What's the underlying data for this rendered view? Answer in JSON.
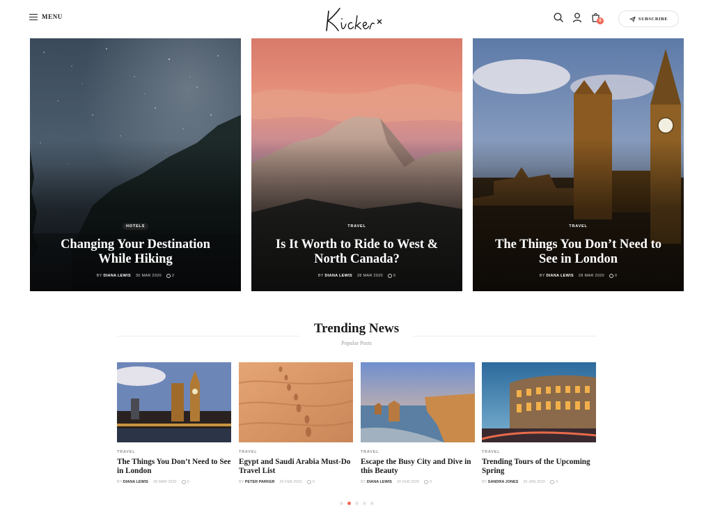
{
  "header": {
    "menu_label": "MENU",
    "logo_text": "Kicker",
    "cart_count": "0",
    "subscribe_label": "SUBSCRIBE",
    "accent_color": "#f06a57"
  },
  "hero": [
    {
      "category": "HOTELS",
      "title": "Changing Your Destination While Hiking",
      "by": "BY",
      "author": "DIANA LEWIS",
      "date": "30 MAR 2020",
      "comments": "2",
      "image": "starry-night-forest"
    },
    {
      "category": "TRAVEL",
      "title": "Is It Worth to Ride to West & North Canada?",
      "by": "BY",
      "author": "DIANA LEWIS",
      "date": "28 MAR 2020",
      "comments": "0",
      "image": "half-dome-sunset"
    },
    {
      "category": "TRAVEL",
      "title": "The Things You Don’t Need to See in London",
      "by": "BY",
      "author": "DIANA LEWIS",
      "date": "28 MAR 2020",
      "comments": "0",
      "image": "big-ben-westminster"
    }
  ],
  "trending": {
    "title": "Trending News",
    "subtitle": "Popular Posts",
    "posts": [
      {
        "category": "TRAVEL",
        "title": "The Things You Don’t Need to See in London",
        "by": "BY",
        "author": "DIANA LEWIS",
        "date": "28 MAR 2020",
        "comments": "0",
        "image": "london-night"
      },
      {
        "category": "TRAVEL",
        "title": "Egypt and Saudi Arabia Must-Do Travel List",
        "by": "BY",
        "author": "PETER PARKER",
        "date": "25 FEB 2020",
        "comments": "0",
        "image": "desert-footprints"
      },
      {
        "category": "TRAVEL",
        "title": "Escape the Busy City and Dive in this Beauty",
        "by": "BY",
        "author": "DIANA LEWIS",
        "date": "20 FEB 2020",
        "comments": "0",
        "image": "coastal-cliffs"
      },
      {
        "category": "TRAVEL",
        "title": "Trending Tours of the Upcoming Spring",
        "by": "BY",
        "author": "SANDRA JONES",
        "date": "20 JAN 2020",
        "comments": "0",
        "image": "colosseum-night"
      }
    ],
    "pagination": {
      "pages": 5,
      "active": 2
    }
  }
}
